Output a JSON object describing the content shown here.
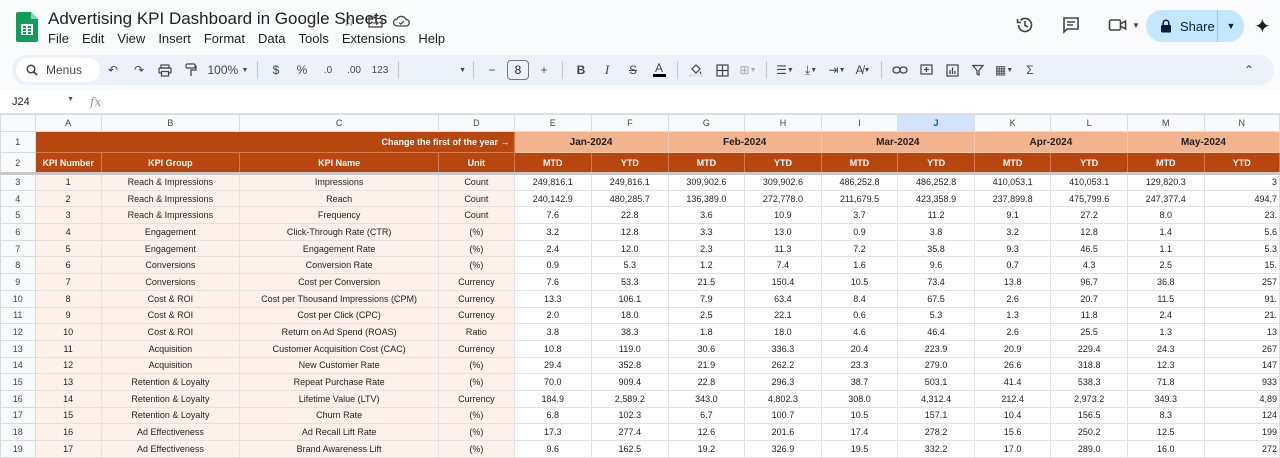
{
  "app": {
    "doc_title": "Advertising KPI Dashboard in Google Sheets",
    "menu": [
      "File",
      "Edit",
      "View",
      "Insert",
      "Format",
      "Data",
      "Tools",
      "Extensions",
      "Help"
    ],
    "share_label": "Share"
  },
  "toolbar": {
    "search_label": "Menus",
    "zoom": "100%",
    "currency": "$",
    "percent": "%",
    "dec_decrease": ".0",
    "dec_increase": ".00",
    "number_format": "123",
    "font_size": "8"
  },
  "formula_bar": {
    "cell_ref": "J24",
    "fx_label": "fx"
  },
  "columns": [
    "A",
    "B",
    "C",
    "D",
    "E",
    "F",
    "G",
    "H",
    "I",
    "J",
    "K",
    "L",
    "M",
    "N"
  ],
  "header_row1": {
    "change_label": "Change the first of the year →",
    "months": [
      "Jan-2024",
      "Feb-2024",
      "Mar-2024",
      "Apr-2024",
      "May-2024"
    ]
  },
  "header_row2": {
    "kpi_number": "KPI Number",
    "kpi_group": "KPI Group",
    "kpi_name": "KPI Name",
    "unit": "Unit",
    "mtd": "MTD",
    "ytd": "YTD"
  },
  "rows": [
    {
      "rn": "3",
      "num": "1",
      "group": "Reach & Impressions",
      "name": "Impressions",
      "unit": "Count",
      "vals": [
        "249,816.1",
        "249,816.1",
        "309,902.6",
        "309,902.6",
        "486,252.8",
        "486,252.8",
        "410,053.1",
        "410,053.1",
        "129,820.3",
        "3"
      ]
    },
    {
      "rn": "4",
      "num": "2",
      "group": "Reach & Impressions",
      "name": "Reach",
      "unit": "Count",
      "vals": [
        "240,142.9",
        "480,285.7",
        "136,389.0",
        "272,778.0",
        "211,679.5",
        "423,358.9",
        "237,899.8",
        "475,799.6",
        "247,377.4",
        "494,7"
      ]
    },
    {
      "rn": "5",
      "num": "3",
      "group": "Reach & Impressions",
      "name": "Frequency",
      "unit": "Count",
      "vals": [
        "7.6",
        "22.8",
        "3.6",
        "10.9",
        "3.7",
        "11.2",
        "9.1",
        "27.2",
        "8.0",
        "23."
      ]
    },
    {
      "rn": "6",
      "num": "4",
      "group": "Engagement",
      "name": "Click-Through Rate (CTR)",
      "unit": "(%)",
      "vals": [
        "3.2",
        "12.8",
        "3.3",
        "13.0",
        "0.9",
        "3.8",
        "3.2",
        "12.8",
        "1.4",
        "5.6"
      ]
    },
    {
      "rn": "7",
      "num": "5",
      "group": "Engagement",
      "name": "Engagement Rate",
      "unit": "(%)",
      "vals": [
        "2.4",
        "12.0",
        "2.3",
        "11.3",
        "7.2",
        "35.8",
        "9.3",
        "46.5",
        "1.1",
        "5.3"
      ]
    },
    {
      "rn": "8",
      "num": "6",
      "group": "Conversions",
      "name": "Conversion Rate",
      "unit": "(%)",
      "vals": [
        "0.9",
        "5.3",
        "1.2",
        "7.4",
        "1.6",
        "9.6",
        "0.7",
        "4.3",
        "2.5",
        "15."
      ]
    },
    {
      "rn": "9",
      "num": "7",
      "group": "Conversions",
      "name": "Cost per Conversion",
      "unit": "Currency",
      "vals": [
        "7.6",
        "53.3",
        "21.5",
        "150.4",
        "10.5",
        "73.4",
        "13.8",
        "96.7",
        "36.8",
        "257"
      ]
    },
    {
      "rn": "10",
      "num": "8",
      "group": "Cost & ROI",
      "name": "Cost per Thousand Impressions (CPM)",
      "unit": "Currency",
      "vals": [
        "13.3",
        "106.1",
        "7.9",
        "63.4",
        "8.4",
        "67.5",
        "2.6",
        "20.7",
        "11.5",
        "91."
      ]
    },
    {
      "rn": "11",
      "num": "9",
      "group": "Cost & ROI",
      "name": "Cost per Click (CPC)",
      "unit": "Currency",
      "vals": [
        "2.0",
        "18.0",
        "2.5",
        "22.1",
        "0.6",
        "5.3",
        "1.3",
        "11.8",
        "2.4",
        "21."
      ]
    },
    {
      "rn": "12",
      "num": "10",
      "group": "Cost & ROI",
      "name": "Return on Ad Spend (ROAS)",
      "unit": "Ratio",
      "vals": [
        "3.8",
        "38.3",
        "1.8",
        "18.0",
        "4.6",
        "46.4",
        "2.6",
        "25.5",
        "1.3",
        "13"
      ]
    },
    {
      "rn": "13",
      "num": "11",
      "group": "Acquisition",
      "name": "Customer Acquisition Cost (CAC)",
      "unit": "Currency",
      "vals": [
        "10.8",
        "119.0",
        "30.6",
        "336.3",
        "20.4",
        "223.9",
        "20.9",
        "229.4",
        "24.3",
        "267"
      ]
    },
    {
      "rn": "14",
      "num": "12",
      "group": "Acquisition",
      "name": "New Customer Rate",
      "unit": "(%)",
      "vals": [
        "29.4",
        "352.8",
        "21.9",
        "262.2",
        "23.3",
        "279.0",
        "26.6",
        "318.8",
        "12.3",
        "147"
      ]
    },
    {
      "rn": "15",
      "num": "13",
      "group": "Retention & Loyalty",
      "name": "Repeat Purchase Rate",
      "unit": "(%)",
      "vals": [
        "70.0",
        "909.4",
        "22.8",
        "296.3",
        "38.7",
        "503.1",
        "41.4",
        "538.3",
        "71.8",
        "933"
      ]
    },
    {
      "rn": "16",
      "num": "14",
      "group": "Retention & Loyalty",
      "name": "Lifetime Value (LTV)",
      "unit": "Currency",
      "vals": [
        "184.9",
        "2,589.2",
        "343.0",
        "4,802.3",
        "308.0",
        "4,312.4",
        "212.4",
        "2,973.2",
        "349.3",
        "4,89"
      ]
    },
    {
      "rn": "17",
      "num": "15",
      "group": "Retention & Loyalty",
      "name": "Churn Rate",
      "unit": "(%)",
      "vals": [
        "6.8",
        "102.3",
        "6.7",
        "100.7",
        "10.5",
        "157.1",
        "10.4",
        "156.5",
        "8.3",
        "124"
      ]
    },
    {
      "rn": "18",
      "num": "16",
      "group": "Ad Effectiveness",
      "name": "Ad Recall Lift Rate",
      "unit": "(%)",
      "vals": [
        "17.3",
        "277.4",
        "12.6",
        "201.6",
        "17.4",
        "278.2",
        "15.6",
        "250.2",
        "12.5",
        "199"
      ]
    },
    {
      "rn": "19",
      "num": "17",
      "group": "Ad Effectiveness",
      "name": "Brand Awareness Lift",
      "unit": "(%)",
      "vals": [
        "9.6",
        "162.5",
        "19.2",
        "326.9",
        "19.5",
        "332.2",
        "17.0",
        "289.0",
        "16.0",
        "272"
      ]
    }
  ]
}
